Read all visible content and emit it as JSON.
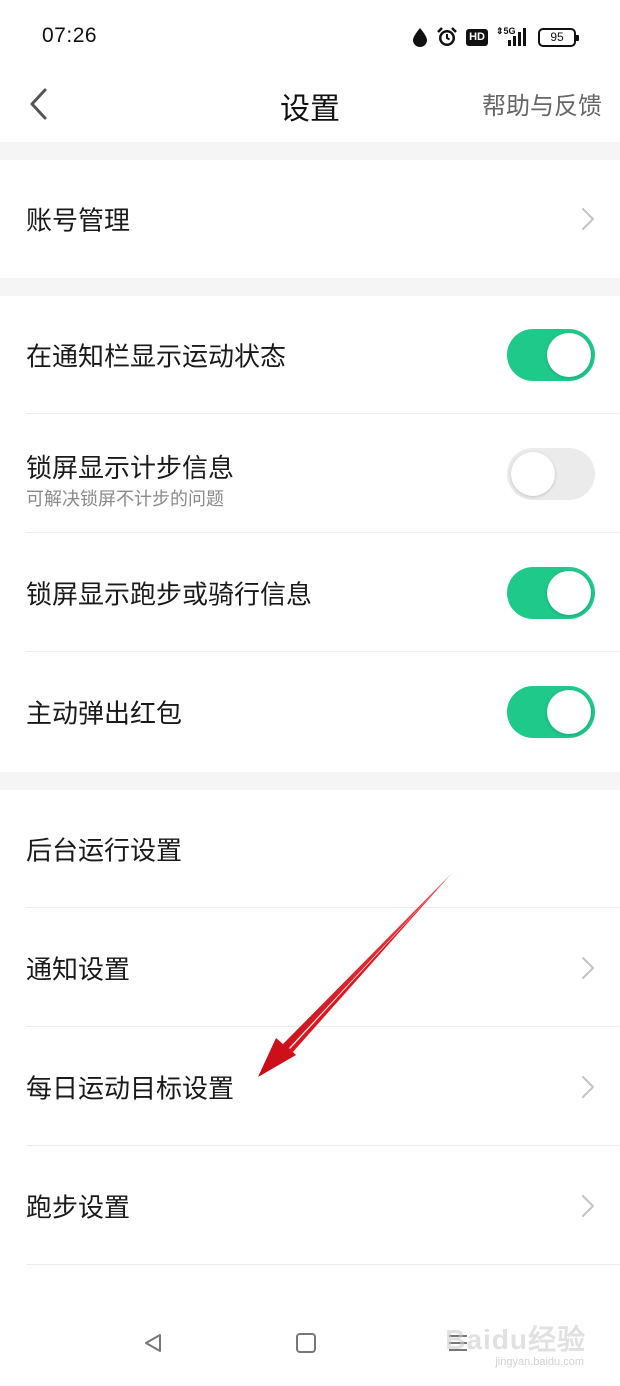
{
  "status_bar": {
    "time": "07:26",
    "battery": "95",
    "hd_label": "HD",
    "network_label": "5G"
  },
  "header": {
    "title": "设置",
    "help_link": "帮助与反馈"
  },
  "sections": {
    "account": {
      "label": "账号管理"
    },
    "toggles": [
      {
        "label": "在通知栏显示运动状态",
        "on": true
      },
      {
        "label": "锁屏显示计步信息",
        "sub": "可解决锁屏不计步的问题",
        "on": false
      },
      {
        "label": "锁屏显示跑步或骑行信息",
        "on": true
      },
      {
        "label": "主动弹出红包",
        "on": true
      }
    ],
    "links": [
      {
        "label": "后台运行设置"
      },
      {
        "label": "通知设置"
      },
      {
        "label": "每日运动目标设置"
      },
      {
        "label": "跑步设置"
      }
    ]
  },
  "watermark": {
    "brand": "Baidu经验",
    "url": "jingyan.baidu.com"
  },
  "colors": {
    "toggle_on": "#1ec98a",
    "toggle_off": "#ebebeb",
    "arrow": "#e0141e"
  },
  "icons": {
    "back": "chevron-left-icon",
    "chevron": "chevron-right-icon",
    "nav_back": "triangle-back-icon",
    "nav_home": "square-home-icon",
    "nav_menu": "menu-lines-icon"
  }
}
